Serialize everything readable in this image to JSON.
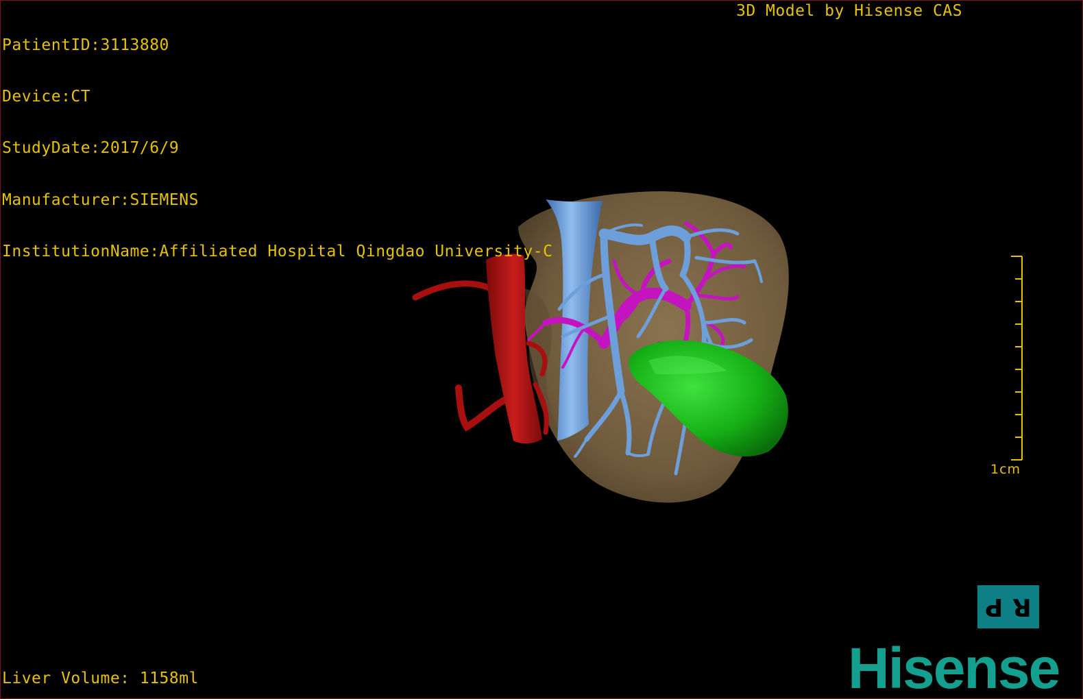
{
  "info": {
    "patient_id": "PatientID:3113880",
    "device": "Device:CT",
    "study_date": "StudyDate:2017/6/9",
    "manufacturer": "Manufacturer:SIEMENS",
    "institution": "InstitutionName:Affiliated Hospital Qingdao University-C"
  },
  "credit": "3D Model by Hisense CAS",
  "volume": "Liver Volume: 1158ml",
  "scale_label": "1cm",
  "orientation": {
    "left": "P",
    "right": "R"
  },
  "logo": "Hisense",
  "colors": {
    "overlay_text": "#e6c200",
    "liver": "#7f6848",
    "aorta": "#b81414",
    "vena_cava": "#6a9fdc",
    "portal_vein": "#c414c0",
    "gallbladder": "#14b414",
    "orient_box": "#0f7f86",
    "logo": "#14a08e"
  }
}
